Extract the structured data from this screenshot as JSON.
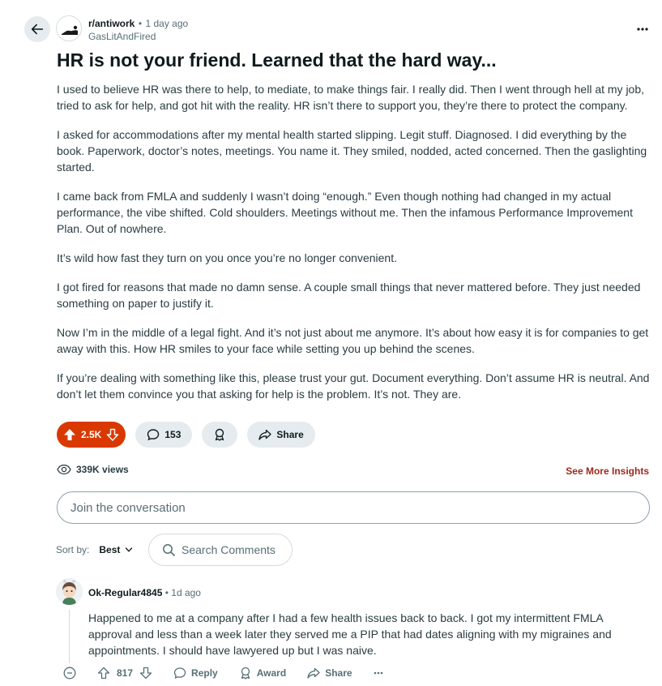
{
  "post": {
    "subreddit": "r/antiwork",
    "separator": "•",
    "time": "1 day ago",
    "author": "GasLitAndFired",
    "title": "HR is not your friend. Learned that the hard way...",
    "paragraphs": [
      "I used to believe HR was there to help, to mediate, to make things fair. I really did. Then I went through hell at my job, tried to ask for help, and got hit with the reality. HR isn’t there to support you, they’re there to protect the company.",
      "I asked for accommodations after my mental health started slipping. Legit stuff. Diagnosed. I did everything by the book. Paperwork, doctor’s notes, meetings. You name it. They smiled, nodded, acted concerned. Then the gaslighting started.",
      "I came back from FMLA and suddenly I wasn’t doing “enough.” Even though nothing had changed in my actual performance, the vibe shifted. Cold shoulders. Meetings without me. Then the infamous Performance Improvement Plan. Out of nowhere.",
      "It’s wild how fast they turn on you once you’re no longer convenient.",
      "I got fired for reasons that made no damn sense. A couple small things that never mattered before. They just needed something on paper to justify it.",
      "Now I’m in the middle of a legal fight. And it’s not just about me anymore. It’s about how easy it is for companies to get away with this. How HR smiles to your face while setting you up behind the scenes.",
      "If you’re dealing with something like this, please trust your gut. Document everything. Don’t assume HR is neutral. And don’t let them convince you that asking for help is the problem. It’s not. They are."
    ],
    "votes": "2.5K",
    "comments_count": "153",
    "share_label": "Share",
    "views": "339K views",
    "insights_label": "See More Insights"
  },
  "conversation": {
    "placeholder": "Join the conversation",
    "sort_label": "Sort by:",
    "sort_value": "Best",
    "search_placeholder": "Search Comments"
  },
  "comment": {
    "author": "Ok-Regular4845",
    "separator": "•",
    "time": "1d ago",
    "body": "Happened to me at a company after I had a few health issues back to back. I got my intermittent FMLA approval and less than a week later they served me a PIP that had dates aligning with my migraines and appointments. I should have lawyered up but I was naive.",
    "votes": "817",
    "reply_label": "Reply",
    "award_label": "Award",
    "share_label": "Share"
  },
  "icons": {
    "back": "arrow-left-icon",
    "more": "ellipsis-icon",
    "upvote": "arrow-up-icon",
    "downvote": "arrow-down-icon",
    "comment": "speech-bubble-icon",
    "award": "award-icon",
    "share": "share-arrow-icon",
    "views": "eye-icon",
    "search": "search-icon",
    "collapse": "minus-circle-icon",
    "chevron": "chevron-down-icon"
  },
  "colors": {
    "upvoted": "#d93900",
    "insights": "#9c2a1b",
    "pill_bg": "#e5ebee"
  }
}
